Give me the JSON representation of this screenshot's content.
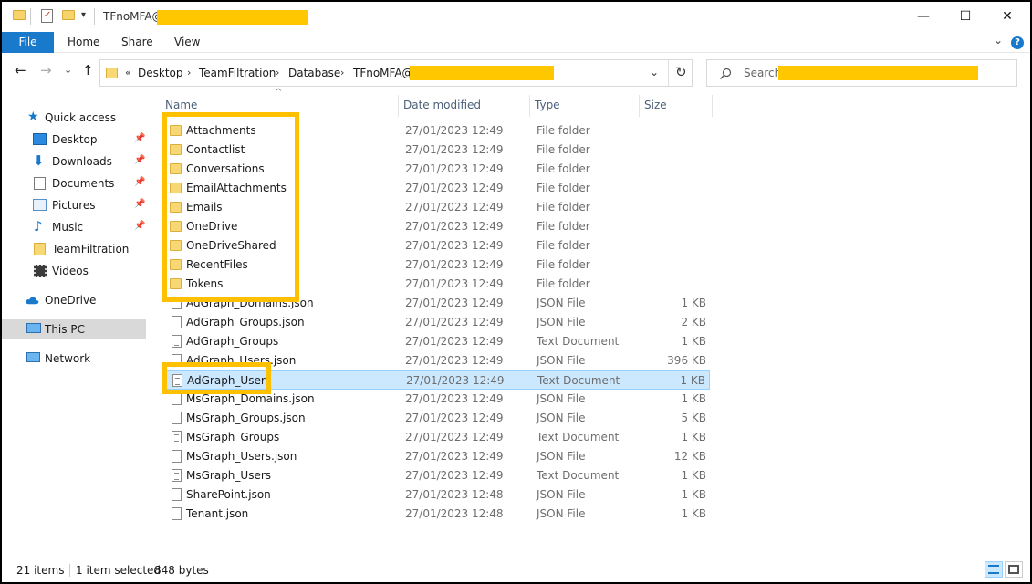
{
  "window": {
    "title": "TFnoMFA@",
    "controls": {
      "minimize": "—",
      "maximize": "☐",
      "close": "✕"
    }
  },
  "ribbon": {
    "tabs": [
      "File",
      "Home",
      "Share",
      "View"
    ],
    "help": "?",
    "collapse": "⌄"
  },
  "navbar": {
    "back": "←",
    "forward": "→",
    "recent": "⌄",
    "up": "↑",
    "breadcrumb_overflow": "«",
    "breadcrumb": [
      "Desktop",
      "TeamFiltration",
      "Database",
      "TFnoMFA@"
    ],
    "separator": "›",
    "dropdown": "⌄",
    "refresh": "↻",
    "search_placeholder": "Search"
  },
  "navpane": {
    "items": [
      {
        "label": "Quick access",
        "icon": "star-icon",
        "pinned": false
      },
      {
        "label": "Desktop",
        "icon": "desktop-icon",
        "pinned": true
      },
      {
        "label": "Downloads",
        "icon": "download-icon",
        "pinned": true
      },
      {
        "label": "Documents",
        "icon": "documents-icon",
        "pinned": true
      },
      {
        "label": "Pictures",
        "icon": "pictures-icon",
        "pinned": true
      },
      {
        "label": "Music",
        "icon": "music-icon",
        "pinned": true
      },
      {
        "label": "TeamFiltration",
        "icon": "folder-icon",
        "pinned": false
      },
      {
        "label": "Videos",
        "icon": "videos-icon",
        "pinned": false
      },
      {
        "label": "OneDrive",
        "icon": "cloud-icon",
        "pinned": false
      },
      {
        "label": "This PC",
        "icon": "computer-icon",
        "pinned": false,
        "selected": true
      },
      {
        "label": "Network",
        "icon": "network-icon",
        "pinned": false
      }
    ],
    "pin_glyph": "📌"
  },
  "columns": {
    "name": "Name",
    "date": "Date modified",
    "type": "Type",
    "size": "Size",
    "sort_glyph": "^"
  },
  "files": [
    {
      "name": "Attachments",
      "date": "27/01/2023 12:49",
      "type": "File folder",
      "size": "",
      "kind": "folder"
    },
    {
      "name": "Contactlist",
      "date": "27/01/2023 12:49",
      "type": "File folder",
      "size": "",
      "kind": "folder"
    },
    {
      "name": "Conversations",
      "date": "27/01/2023 12:49",
      "type": "File folder",
      "size": "",
      "kind": "folder"
    },
    {
      "name": "EmailAttachments",
      "date": "27/01/2023 12:49",
      "type": "File folder",
      "size": "",
      "kind": "folder"
    },
    {
      "name": "Emails",
      "date": "27/01/2023 12:49",
      "type": "File folder",
      "size": "",
      "kind": "folder"
    },
    {
      "name": "OneDrive",
      "date": "27/01/2023 12:49",
      "type": "File folder",
      "size": "",
      "kind": "folder"
    },
    {
      "name": "OneDriveShared",
      "date": "27/01/2023 12:49",
      "type": "File folder",
      "size": "",
      "kind": "folder"
    },
    {
      "name": "RecentFiles",
      "date": "27/01/2023 12:49",
      "type": "File folder",
      "size": "",
      "kind": "folder"
    },
    {
      "name": "Tokens",
      "date": "27/01/2023 12:49",
      "type": "File folder",
      "size": "",
      "kind": "folder"
    },
    {
      "name": "AdGraph_Domains.json",
      "date": "27/01/2023 12:49",
      "type": "JSON File",
      "size": "1 KB",
      "kind": "json"
    },
    {
      "name": "AdGraph_Groups.json",
      "date": "27/01/2023 12:49",
      "type": "JSON File",
      "size": "2 KB",
      "kind": "json"
    },
    {
      "name": "AdGraph_Groups",
      "date": "27/01/2023 12:49",
      "type": "Text Document",
      "size": "1 KB",
      "kind": "text"
    },
    {
      "name": "AdGraph_Users.json",
      "date": "27/01/2023 12:49",
      "type": "JSON File",
      "size": "396 KB",
      "kind": "json"
    },
    {
      "name": "AdGraph_Users",
      "date": "27/01/2023 12:49",
      "type": "Text Document",
      "size": "1 KB",
      "kind": "text",
      "selected": true
    },
    {
      "name": "MsGraph_Domains.json",
      "date": "27/01/2023 12:49",
      "type": "JSON File",
      "size": "1 KB",
      "kind": "json"
    },
    {
      "name": "MsGraph_Groups.json",
      "date": "27/01/2023 12:49",
      "type": "JSON File",
      "size": "5 KB",
      "kind": "json"
    },
    {
      "name": "MsGraph_Groups",
      "date": "27/01/2023 12:49",
      "type": "Text Document",
      "size": "1 KB",
      "kind": "text"
    },
    {
      "name": "MsGraph_Users.json",
      "date": "27/01/2023 12:49",
      "type": "JSON File",
      "size": "12 KB",
      "kind": "json"
    },
    {
      "name": "MsGraph_Users",
      "date": "27/01/2023 12:49",
      "type": "Text Document",
      "size": "1 KB",
      "kind": "text"
    },
    {
      "name": "SharePoint.json",
      "date": "27/01/2023 12:48",
      "type": "JSON File",
      "size": "1 KB",
      "kind": "json"
    },
    {
      "name": "Tenant.json",
      "date": "27/01/2023 12:48",
      "type": "JSON File",
      "size": "1 KB",
      "kind": "json"
    }
  ],
  "status": {
    "items": "21 items",
    "selected": "1 item selected",
    "bytes": "848 bytes"
  },
  "colors": {
    "highlight": "#ffc000",
    "redaction": "#ffc700",
    "accent": "#1979ca",
    "selection": "#cce8ff"
  }
}
